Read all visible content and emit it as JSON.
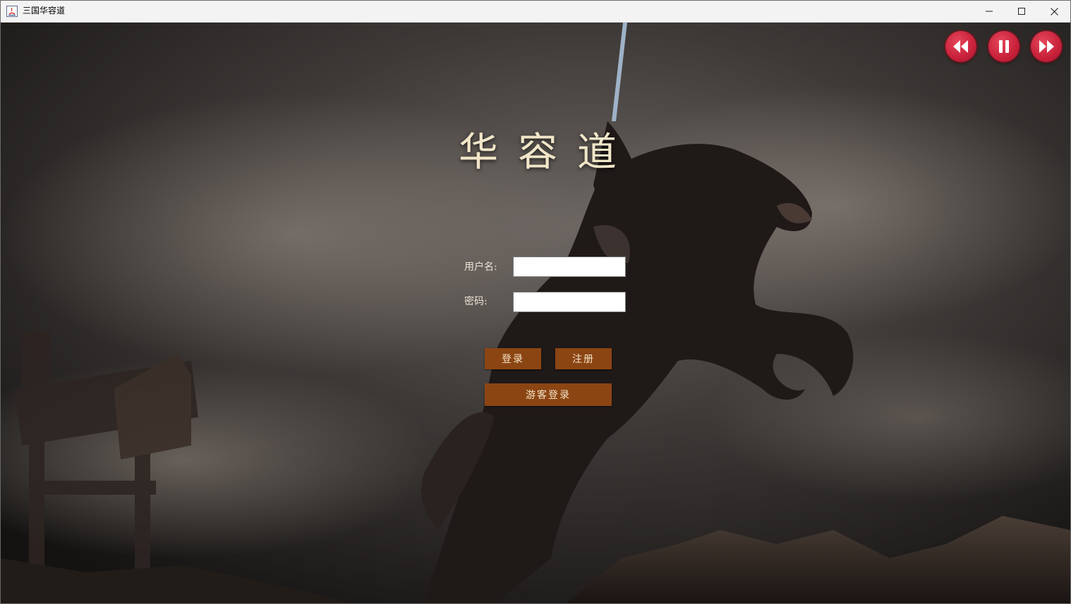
{
  "window": {
    "title": "三国华容道",
    "controls": {
      "minimize": "minimize-icon",
      "maximize": "maximize-icon",
      "close": "close-icon"
    }
  },
  "media_controls": [
    {
      "name": "rewind-icon"
    },
    {
      "name": "pause-icon"
    },
    {
      "name": "fast-forward-icon"
    }
  ],
  "login": {
    "title": "华容道",
    "username_label": "用户名:",
    "username_value": "",
    "password_label": "密码:",
    "password_value": "",
    "login_button": "登录",
    "register_button": "注册",
    "guest_button": "游客登录"
  },
  "colors": {
    "button": "#8b4513",
    "media_button": "#c8203a",
    "title_text": "#f1e6c8"
  }
}
